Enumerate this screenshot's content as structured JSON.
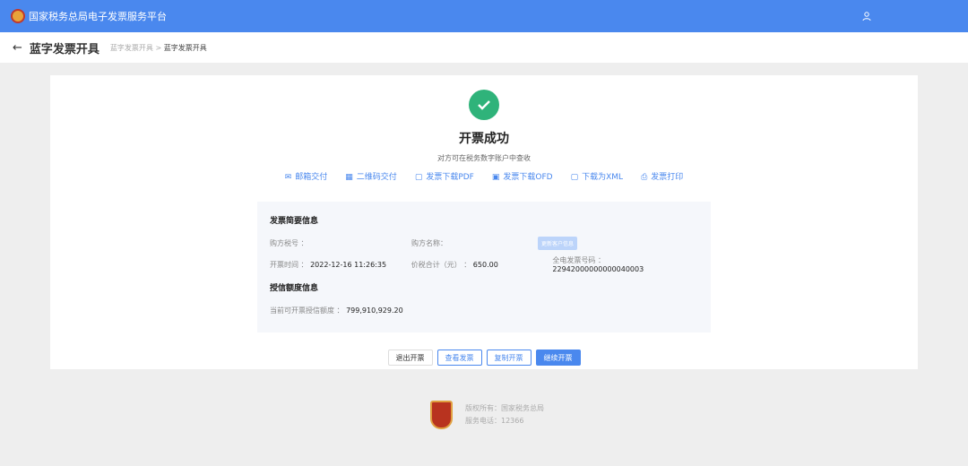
{
  "header": {
    "site_title": "国家税务总局电子发票服务平台"
  },
  "subheader": {
    "back": "←",
    "title": "蓝字发票开具",
    "breadcrumb": [
      "蓝字发票开具",
      "蓝字发票开具"
    ],
    "separator": ">"
  },
  "result": {
    "title": "开票成功",
    "subtitle": "对方可在税务数字账户中查收",
    "status_color": "#2fb37a"
  },
  "actions": [
    {
      "icon": "mail-icon",
      "glyph": "✉",
      "label": "邮箱交付"
    },
    {
      "icon": "qrcode-icon",
      "glyph": "▦",
      "label": "二维码交付"
    },
    {
      "icon": "file-icon",
      "glyph": "▢",
      "label": "发票下载PDF"
    },
    {
      "icon": "folder-icon",
      "glyph": "▣",
      "label": "发票下载OFD"
    },
    {
      "icon": "file-icon",
      "glyph": "▢",
      "label": "下载为XML"
    },
    {
      "icon": "printer-icon",
      "glyph": "⎙",
      "label": "发票打印"
    }
  ],
  "invoice": {
    "section_title": "发票简要信息",
    "buyer_tax_label": "购方税号 ：",
    "buyer_name_label": "购方名称：",
    "update_button": "更新客户信息",
    "time_label": "开票时间 ：",
    "time": "2022-12-16 11:26:35",
    "total_label": "价税合计（元） ：",
    "total": "650.00",
    "number_label": "全电发票号码 ：",
    "number": "22942000000000040003"
  },
  "credit": {
    "section_title": "授信额度信息",
    "label": "当前可开票授信额度 ：",
    "value": "799,910,929.20"
  },
  "buttons": {
    "exit": "退出开票",
    "view": "查看发票",
    "copy": "复制开票",
    "continue": "继续开票"
  },
  "footer": {
    "copyright": "版权所有：国家税务总局",
    "phone": "服务电话：12366"
  },
  "colors": {
    "primary": "#4a88ee"
  }
}
